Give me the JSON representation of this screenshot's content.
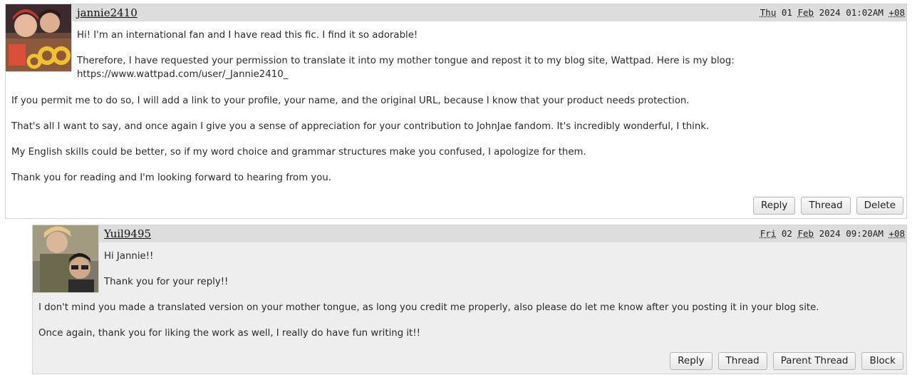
{
  "comments": [
    {
      "username": "jannie2410",
      "date": {
        "weekday": "Thu",
        "day": "01",
        "month": "Feb",
        "year_time": "2024 01:02AM",
        "tz": "+08"
      },
      "paragraphs": [
        "Hi! I'm an international fan and I have read this fic. I find it so adorable!",
        "Therefore, I have requested your permission to translate it into my mother tongue and repost it to my blog site, Wattpad. Here is my blog:",
        "https://www.wattpad.com/user/_Jannie2410_",
        "If you permit me to do so, I will add a link to your profile, your name, and the original URL, because I know that your product needs protection.",
        "That's all I want to say, and once again I give you a sense of appreciation for your contribution to JohnJae fandom. It's incredibly wonderful, I think.",
        "My English skills could be better, so if my word choice and grammar structures make you confused, I apologize for them.",
        "Thank you for reading and I'm looking forward to hearing from you."
      ],
      "buttons": [
        "Reply",
        "Thread",
        "Delete"
      ]
    },
    {
      "username": "Yuil9495",
      "date": {
        "weekday": "Fri",
        "day": "02",
        "month": "Feb",
        "year_time": "2024 09:20AM",
        "tz": "+08"
      },
      "paragraphs": [
        "Hi Jannie!!",
        "Thank you for your reply!!",
        "I don't mind you made a translated version on your mother tongue, as long you credit me properly, also please do let me know after you posting it in your blog site.",
        "Once again, thank you for liking the work as well, I really do have fun writing it!!"
      ],
      "buttons": [
        "Reply",
        "Thread",
        "Parent Thread",
        "Block"
      ]
    }
  ]
}
